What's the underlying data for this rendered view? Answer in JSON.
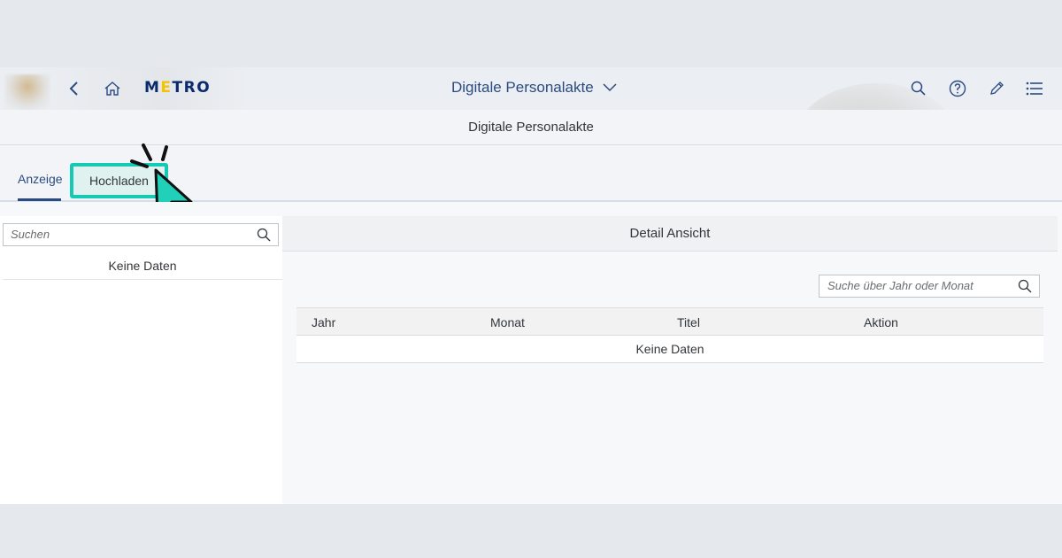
{
  "shell": {
    "logo": {
      "text_pre": "M",
      "text_accent": "E",
      "text_post": "TRO"
    },
    "app_title": "Digitale Personalakte",
    "icons": [
      "back-icon",
      "home-icon",
      "search-icon",
      "help-icon",
      "edit-icon",
      "menu-list-icon"
    ]
  },
  "page": {
    "title": "Digitale Personalakte"
  },
  "tabs": [
    {
      "label": "Anzeige",
      "selected": true
    },
    {
      "label": "Hochladen",
      "selected": false,
      "highlighted": true
    }
  ],
  "master": {
    "search_placeholder": "Suchen",
    "no_data": "Keine Daten"
  },
  "detail": {
    "title": "Detail Ansicht",
    "search_placeholder": "Suche über Jahr oder Monat",
    "columns": [
      "Jahr",
      "Monat",
      "Titel",
      "Aktion"
    ],
    "no_data": "Keine Daten"
  },
  "colors": {
    "accent": "#2b4b80",
    "highlight": "#15c9b2",
    "logo_blue": "#0a2a6b",
    "logo_yellow": "#f5c400"
  }
}
